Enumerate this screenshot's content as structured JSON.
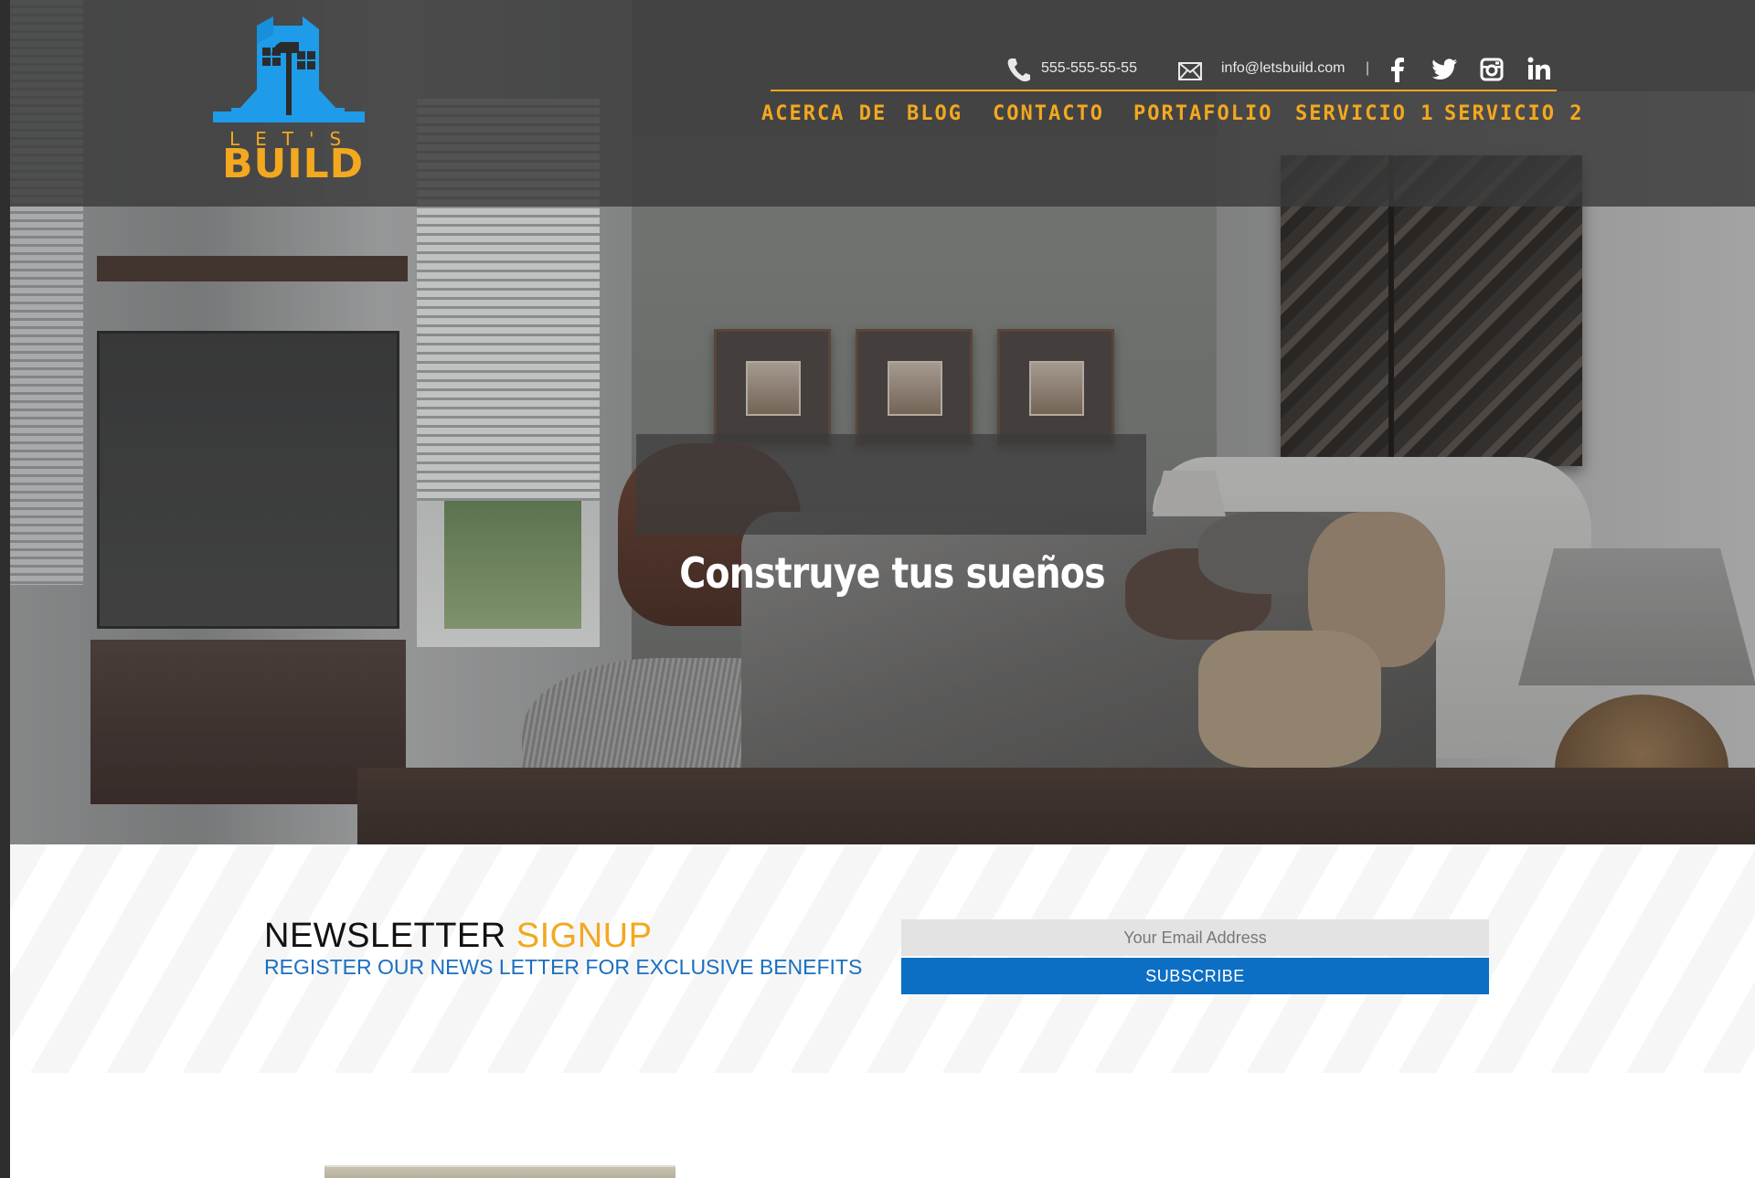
{
  "brand": {
    "logo_small_text": "LET'S",
    "logo_big_text": "BUILD",
    "colors": {
      "orange": "#f3a81f",
      "blue": "#1e9be9",
      "dark_header": "#3a3a3a",
      "subscribe_blue": "#0d6fc4"
    }
  },
  "contact": {
    "phone": "555-555-55-55",
    "email": "info@letsbuild.com",
    "separator": "|",
    "phone_icon": "phone-icon",
    "email_icon": "envelope-icon"
  },
  "social": [
    "facebook-icon",
    "twitter-icon",
    "instagram-icon",
    "linkedin-icon"
  ],
  "nav": {
    "items": [
      "ACERCA DE",
      "BLOG",
      "CONTACTO",
      "PORTAFOLIO",
      "SERVICIO 1",
      "SERVICIO 2"
    ]
  },
  "hero": {
    "title": "Construye tus sueños"
  },
  "newsletter": {
    "title_part1": "NEWSLETTER",
    "title_part2": "SIGNUP",
    "subtitle": "REGISTER OUR NEWS LETTER FOR EXCLUSIVE BENEFITS",
    "email_placeholder": "Your Email Address",
    "subscribe_label": "SUBSCRIBE"
  }
}
